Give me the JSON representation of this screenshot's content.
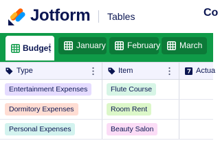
{
  "header": {
    "brand": "Jotform",
    "app_name": "Tables",
    "right_text": "Co"
  },
  "tabs": [
    {
      "label": "Budget",
      "active": true
    },
    {
      "label": "January",
      "active": false
    },
    {
      "label": "February",
      "active": false
    },
    {
      "label": "March",
      "active": false
    }
  ],
  "table": {
    "columns": [
      {
        "label": "Type",
        "icon": "tag-icon"
      },
      {
        "label": "Item",
        "icon": "tag-icon"
      },
      {
        "label": "Actua",
        "icon": "number-icon"
      }
    ],
    "rows": [
      {
        "type": "Entertainment Expenses",
        "type_color": "#e5dcff",
        "item": "Flute Course",
        "item_color": "#d7f5e6"
      },
      {
        "type": "Dormitory Expenses",
        "type_color": "#ffddd3",
        "item": "Room Rent",
        "item_color": "#dcf7c9"
      },
      {
        "type": "Personal Expenses",
        "type_color": "#d3f3ef",
        "item": "Beauty Salon",
        "item_color": "#fbdcf6"
      }
    ]
  },
  "colors": {
    "brand_green": "#0f9b48",
    "tab_inactive": "#0c7a38",
    "navy": "#0a1551"
  }
}
